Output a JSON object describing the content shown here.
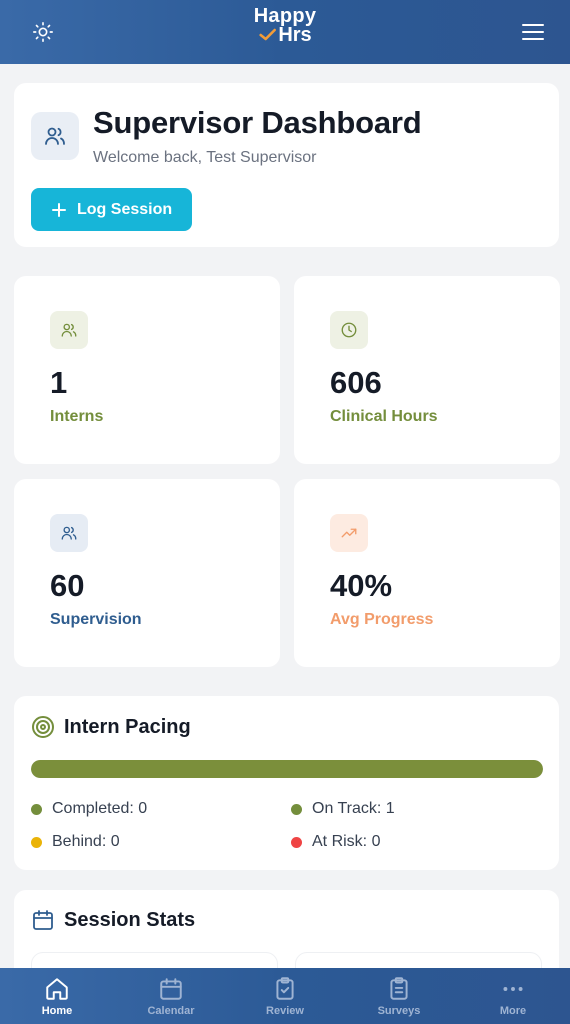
{
  "header": {
    "logo_line1": "Happy",
    "logo_line2": "Hrs",
    "theme_icon": "sun-icon",
    "menu_icon": "hamburger-menu-icon"
  },
  "welcome": {
    "title": "Supervisor Dashboard",
    "subtitle": "Welcome back, Test Supervisor",
    "log_button": "Log Session",
    "avatar_icon": "users-icon"
  },
  "stats": [
    {
      "value": "1",
      "label": "Interns",
      "icon": "users-icon",
      "color": "#748e3c",
      "bg": "#eef1e4"
    },
    {
      "value": "606",
      "label": "Clinical Hours",
      "icon": "clock-icon",
      "color": "#748e3c",
      "bg": "#eef1e4"
    },
    {
      "value": "60",
      "label": "Supervision",
      "icon": "users-icon",
      "color": "#2f5d8f",
      "bg": "#e6ecf4"
    },
    {
      "value": "40%",
      "label": "Avg Progress",
      "icon": "trending-up-icon",
      "color": "#f29c6b",
      "bg": "#fdebe1"
    }
  ],
  "pacing": {
    "title": "Intern Pacing",
    "on_track_fraction": 1.0,
    "legend": [
      {
        "label": "Completed: 0",
        "color": "#748e3c"
      },
      {
        "label": "On Track: 1",
        "color": "#748e3c"
      },
      {
        "label": "Behind: 0",
        "color": "#eab308"
      },
      {
        "label": "At Risk: 0",
        "color": "#ef4444"
      }
    ]
  },
  "session_stats": {
    "title": "Session Stats"
  },
  "nav": [
    {
      "label": "Home",
      "icon": "home-icon",
      "active": true
    },
    {
      "label": "Calendar",
      "icon": "calendar-icon",
      "active": false
    },
    {
      "label": "Review",
      "icon": "clipboard-check-icon",
      "active": false
    },
    {
      "label": "Surveys",
      "icon": "clipboard-list-icon",
      "active": false
    },
    {
      "label": "More",
      "icon": "more-dots-icon",
      "active": false
    }
  ],
  "colors": {
    "header_bg": "#2f5d98",
    "accent_button": "#17b5d8",
    "pacing_bar": "#7b8f3b"
  }
}
